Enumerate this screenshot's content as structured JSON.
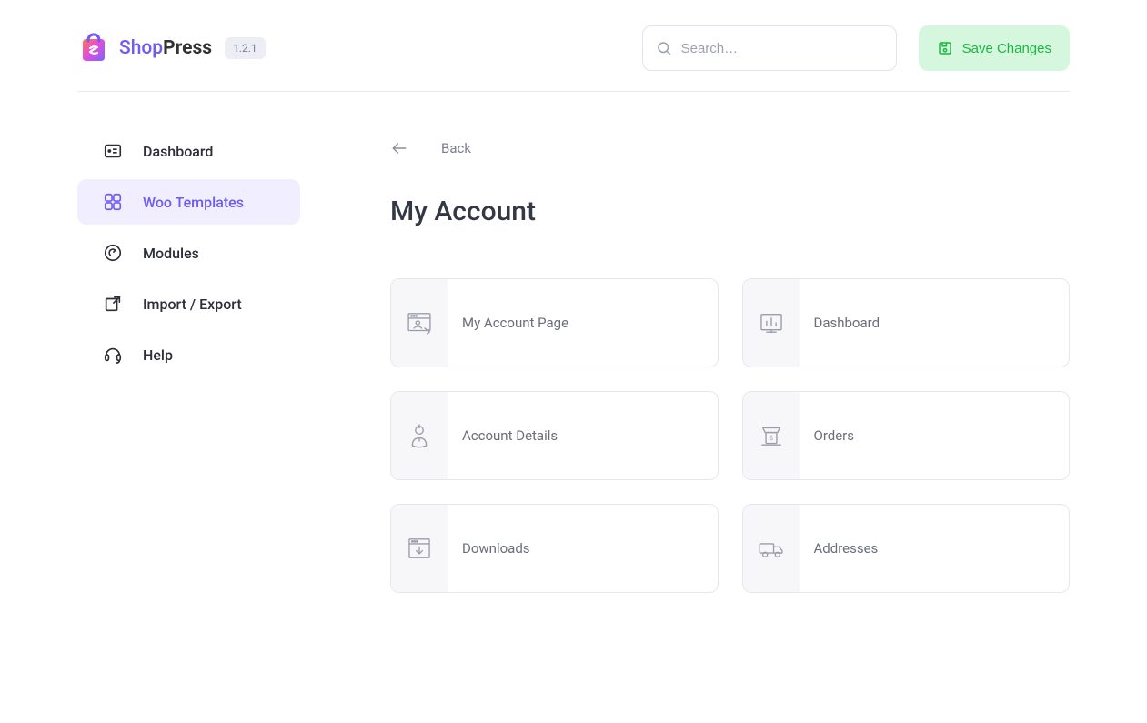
{
  "brand": {
    "name_a": "Shop",
    "name_b": "Press",
    "version": "1.2.1"
  },
  "header": {
    "search_placeholder": "Search…",
    "save_label": "Save Changes"
  },
  "sidebar": {
    "items": [
      {
        "label": "Dashboard"
      },
      {
        "label": "Woo Templates"
      },
      {
        "label": "Modules"
      },
      {
        "label": "Import / Export"
      },
      {
        "label": "Help"
      }
    ]
  },
  "main": {
    "back_label": "Back",
    "title": "My Account",
    "cards": [
      {
        "label": "My Account Page"
      },
      {
        "label": "Dashboard"
      },
      {
        "label": "Account Details"
      },
      {
        "label": "Orders"
      },
      {
        "label": "Downloads"
      },
      {
        "label": "Addresses"
      }
    ]
  }
}
